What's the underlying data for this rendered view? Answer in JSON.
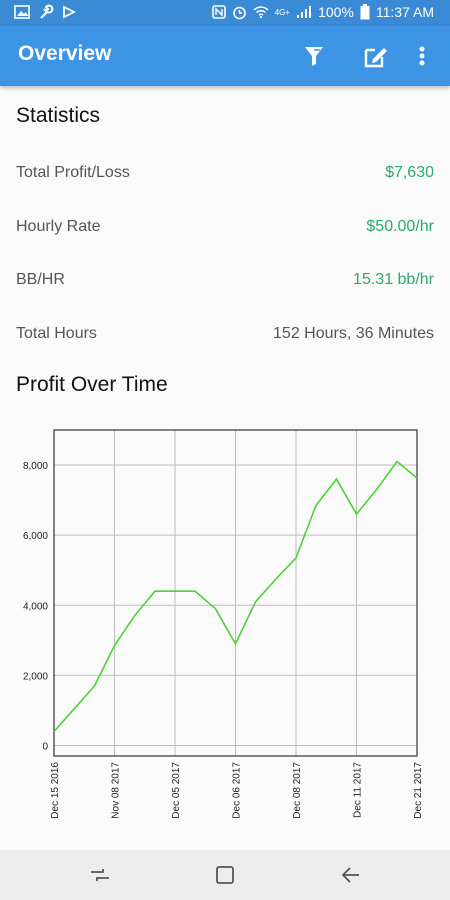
{
  "status_bar": {
    "battery": "100%",
    "time": "11:37 AM",
    "network_label": "4G+",
    "icons": [
      "gallery-icon",
      "wrench-icon",
      "media-icon",
      "nfc-icon",
      "alarm-icon",
      "wifi-icon",
      "signal-icon",
      "battery-icon"
    ]
  },
  "app_bar": {
    "title": "Overview",
    "actions": [
      "filter-icon",
      "edit-icon",
      "more-vert-icon"
    ],
    "color": "#3d93e4"
  },
  "statistics": {
    "title": "Statistics",
    "rows": [
      {
        "label": "Total Profit/Loss",
        "value": "$7,630",
        "color": "#2eaa6a"
      },
      {
        "label": "Hourly Rate",
        "value": "$50.00/hr",
        "color": "#2eaa6a"
      },
      {
        "label": "BB/HR",
        "value": "15.31 bb/hr",
        "color": "#2eaa6a"
      },
      {
        "label": "Total Hours",
        "value": "152 Hours, 36 Minutes",
        "color": "#555555"
      }
    ]
  },
  "chart_section": {
    "title": "Profit Over Time"
  },
  "chart_data": {
    "type": "line",
    "title": "",
    "xlabel": "",
    "ylabel": "",
    "ylim": [
      -300,
      9000
    ],
    "yticks": [
      0,
      2000,
      4000,
      6000,
      8000
    ],
    "ytick_labels": [
      "0",
      "2,000",
      "4,000",
      "6,000",
      "8,000"
    ],
    "xtick_labels": [
      "Dec 15 2016",
      "Nov 08 2017",
      "Dec 05 2017",
      "Dec 06 2017",
      "Dec 08 2017",
      "Dec 11 2017",
      "Dec 21 2017"
    ],
    "grid": true,
    "line_color": "#4cd137",
    "series": [
      {
        "x": [
          0,
          0.67,
          1,
          1.33,
          1.67,
          2,
          2.33,
          2.67,
          3,
          3.33,
          3.67,
          4,
          4.33,
          4.67,
          5,
          5.33,
          5.67,
          6
        ],
        "y": [
          400,
          1700,
          2850,
          3700,
          4400,
          4400,
          4400,
          3900,
          2900,
          4100,
          4750,
          5350,
          6850,
          7600,
          6600,
          7300,
          8100,
          7630
        ]
      }
    ]
  },
  "nav_bar": {
    "buttons": [
      "recent-apps-icon",
      "home-icon",
      "back-icon"
    ]
  }
}
